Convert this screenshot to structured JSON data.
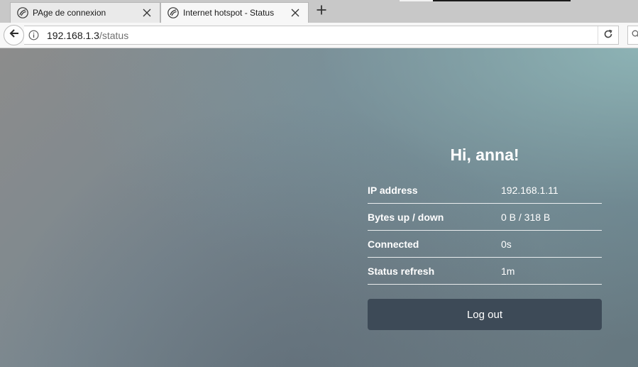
{
  "browser": {
    "tabs": [
      {
        "title": "PAge de connexion",
        "active": false
      },
      {
        "title": "Internet hotspot - Status",
        "active": true
      }
    ],
    "url": {
      "host": "192.168.1.3",
      "path": "/status"
    }
  },
  "status": {
    "greeting": "Hi, anna!",
    "rows": [
      {
        "label": "IP address",
        "value": "192.168.1.11"
      },
      {
        "label": "Bytes up / down",
        "value": "0 B / 318 B"
      },
      {
        "label": "Connected",
        "value": "0s"
      },
      {
        "label": "Status refresh",
        "value": "1m"
      }
    ],
    "logout_label": "Log out"
  },
  "colors": {
    "button_bg": "#3d4a57",
    "text": "#ffffff"
  },
  "icons": {
    "favicon": "mikrotik-logo-icon",
    "back": "back-arrow-icon",
    "info": "info-icon",
    "reload": "reload-icon",
    "close": "close-icon",
    "new_tab": "plus-icon",
    "search": "search-icon"
  }
}
